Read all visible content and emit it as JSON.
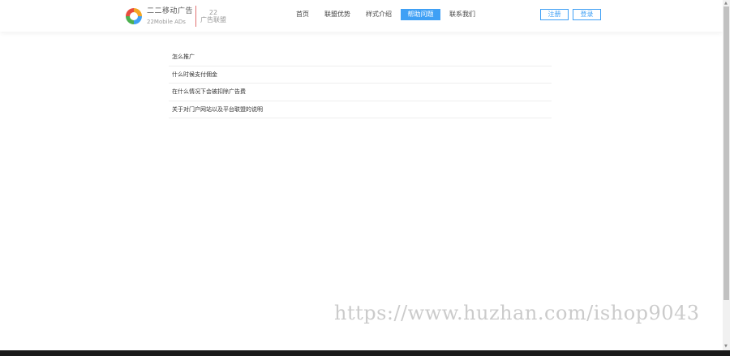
{
  "brand": {
    "name": "二二移动广告",
    "sub": "22Mobile ADs",
    "union_number": "22",
    "union_name": "广告联盟"
  },
  "nav": {
    "items": [
      {
        "label": "首页"
      },
      {
        "label": "联盟优势"
      },
      {
        "label": "样式介绍"
      },
      {
        "label": "帮助问题"
      },
      {
        "label": "联系我们"
      }
    ],
    "active_index": 3
  },
  "auth": {
    "register_label": "注册",
    "login_label": "登录"
  },
  "faq": {
    "items": [
      {
        "title": "怎么推广"
      },
      {
        "title": "什么时候支付佣金"
      },
      {
        "title": "在什么情况下会被扣除广告费"
      },
      {
        "title": "关于对门户网站以及平台联盟的说明"
      }
    ]
  },
  "watermark": {
    "text": "https://www.huzhan.com/ishop9043"
  },
  "colors": {
    "accent": "#3fa0f5",
    "divider": "#e07070",
    "footer": "#1a1a1a"
  }
}
